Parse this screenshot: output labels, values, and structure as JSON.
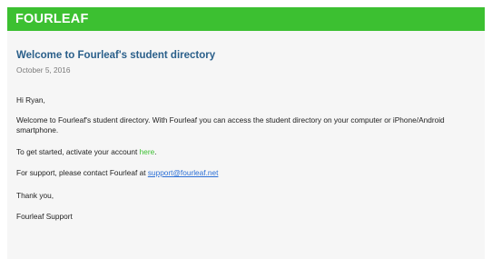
{
  "header": {
    "brand": "FOURLEAF",
    "brand_color": "#3cc031"
  },
  "email": {
    "title": "Welcome to Fourleaf's student directory",
    "date": "October 5, 2016",
    "greeting": "Hi Ryan,",
    "intro": "Welcome to Fourleaf's student directory. With Fourleaf you can access the student directory on your computer or iPhone/Android smartphone.",
    "get_started_prefix": "To get started, activate your account ",
    "get_started_link": "here",
    "get_started_suffix": ".",
    "support_prefix": "For support, please contact Fourleaf at ",
    "support_email": "support@fourleaf.net",
    "thanks": "Thank you,",
    "signature": "Fourleaf Support"
  }
}
